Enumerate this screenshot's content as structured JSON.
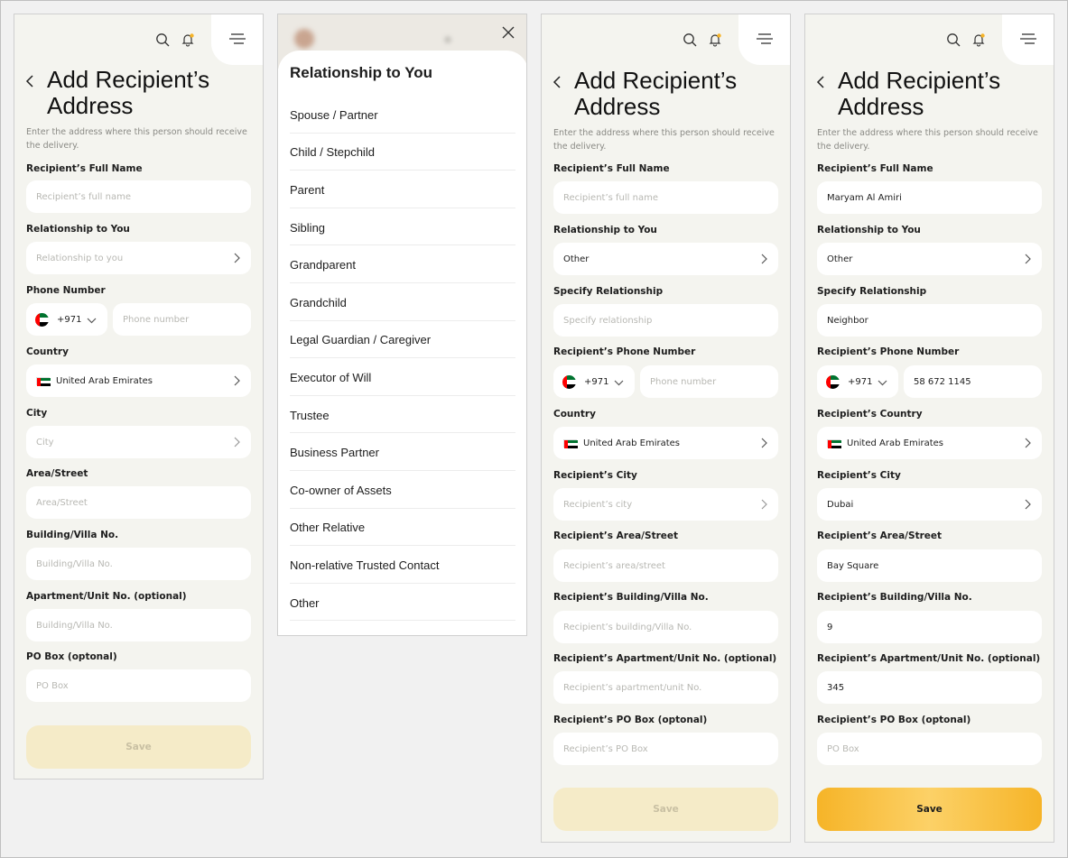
{
  "colors": {
    "accent": "#f6b428",
    "background": "#f4f4ef",
    "field": "#ffffff",
    "placeholder": "#b8b8b3",
    "disabled_button": "#f5ebc8"
  },
  "flag": "uae-flag-icon",
  "s1": {
    "title": "Add Recipient’s Address",
    "subtitle": "Enter the address where this person should receive the delivery.",
    "name_label": "Recipient’s Full Name",
    "name_ph": "Recipient’s full name",
    "rel_label": "Relationship to You",
    "rel_ph": "Relationship to you",
    "phone_label": "Phone Number",
    "dial_code": "+971",
    "phone_ph": "Phone number",
    "country_label": "Country",
    "country_value": "United Arab Emirates",
    "city_label": "City",
    "city_ph": "City",
    "area_label": "Area/Street",
    "area_ph": "Area/Street",
    "building_label": "Building/Villa No.",
    "building_ph": "Building/Villa No.",
    "apt_label": "Apartment/Unit No. (optional)",
    "apt_ph": "Building/Villa No.",
    "po_label": "PO Box (optonal)",
    "po_ph": "PO Box",
    "save": "Save"
  },
  "s2": {
    "title": "Relationship to You",
    "options": [
      "Spouse / Partner",
      "Child / Stepchild",
      "Parent",
      "Sibling",
      "Grandparent",
      "Grandchild",
      "Legal Guardian / Caregiver",
      "Executor of Will",
      "Trustee",
      "Business Partner",
      "Co-owner of Assets",
      "Other Relative",
      "Non-relative Trusted Contact",
      "Other"
    ]
  },
  "s3": {
    "title": "Add Recipient’s Address",
    "subtitle": "Enter the address where this person should receive the delivery.",
    "name_label": "Recipient’s Full Name",
    "name_ph": "Recipient’s full name",
    "rel_label": "Relationship to You",
    "rel_value": "Other",
    "spec_label": "Specify Relationship",
    "spec_ph": "Specify relationship",
    "phone_label": "Recipient’s Phone Number",
    "dial_code": "+971",
    "phone_ph": "Phone number",
    "country_label": "Country",
    "country_value": "United Arab Emirates",
    "city_label": "Recipient’s City",
    "city_ph": "Recipient’s city",
    "area_label": "Recipient’s Area/Street",
    "area_ph": "Recipient’s area/street",
    "building_label": "Recipient’s Building/Villa No.",
    "building_ph": "Recipient’s building/Villa No.",
    "apt_label": "Recipient’s Apartment/Unit No. (optional)",
    "apt_ph": "Recipient’s apartment/unit No.",
    "po_label": "Recipient’s PO Box (optonal)",
    "po_ph": "Recipient’s PO Box",
    "save": "Save"
  },
  "s4": {
    "title": "Add Recipient’s Address",
    "subtitle": "Enter the address where this person should receive the delivery.",
    "name_label": "Recipient’s Full Name",
    "name_value": "Maryam Al Amiri",
    "rel_label": "Relationship to You",
    "rel_value": "Other",
    "spec_label": "Specify Relationship",
    "spec_value": "Neighbor",
    "phone_label": "Recipient’s Phone Number",
    "dial_code": "+971",
    "phone_value": "58 672 1145",
    "country_label": "Recipient’s Country",
    "country_value": "United Arab Emirates",
    "city_label": "Recipient’s City",
    "city_value": "Dubai",
    "area_label": "Recipient’s Area/Street",
    "area_value": "Bay Square",
    "building_label": "Recipient’s Building/Villa No.",
    "building_value": "9",
    "apt_label": "Recipient’s Apartment/Unit No. (optional)",
    "apt_value": "345",
    "po_label": "Recipient’s PO Box (optonal)",
    "po_ph": "PO Box",
    "save": "Save"
  }
}
